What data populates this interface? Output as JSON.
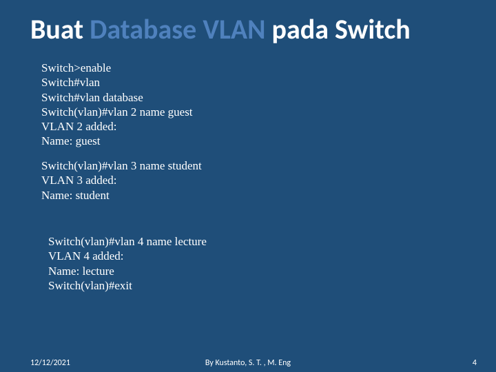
{
  "title": {
    "pre": "Buat ",
    "accent": "Database VLAN",
    "post": " pada Switch"
  },
  "block1": {
    "l1": "Switch>enable",
    "l2": "Switch#vlan",
    "l3": "Switch#vlan database",
    "l4": "Switch(vlan)#vlan 2 name guest",
    "l5": "VLAN 2 added:",
    "l6": "Name: guest"
  },
  "block2": {
    "l1": "Switch(vlan)#vlan 3 name student",
    "l2": "VLAN 3 added:",
    "l3": "Name: student"
  },
  "block3": {
    "l1": "Switch(vlan)#vlan 4 name lecture",
    "l2": "VLAN 4 added:",
    "l3": "Name: lecture",
    "l4": "Switch(vlan)#exit"
  },
  "footer": {
    "date": "12/12/2021",
    "author": "By Kustanto, S. T. , M. Eng",
    "page": "4"
  }
}
